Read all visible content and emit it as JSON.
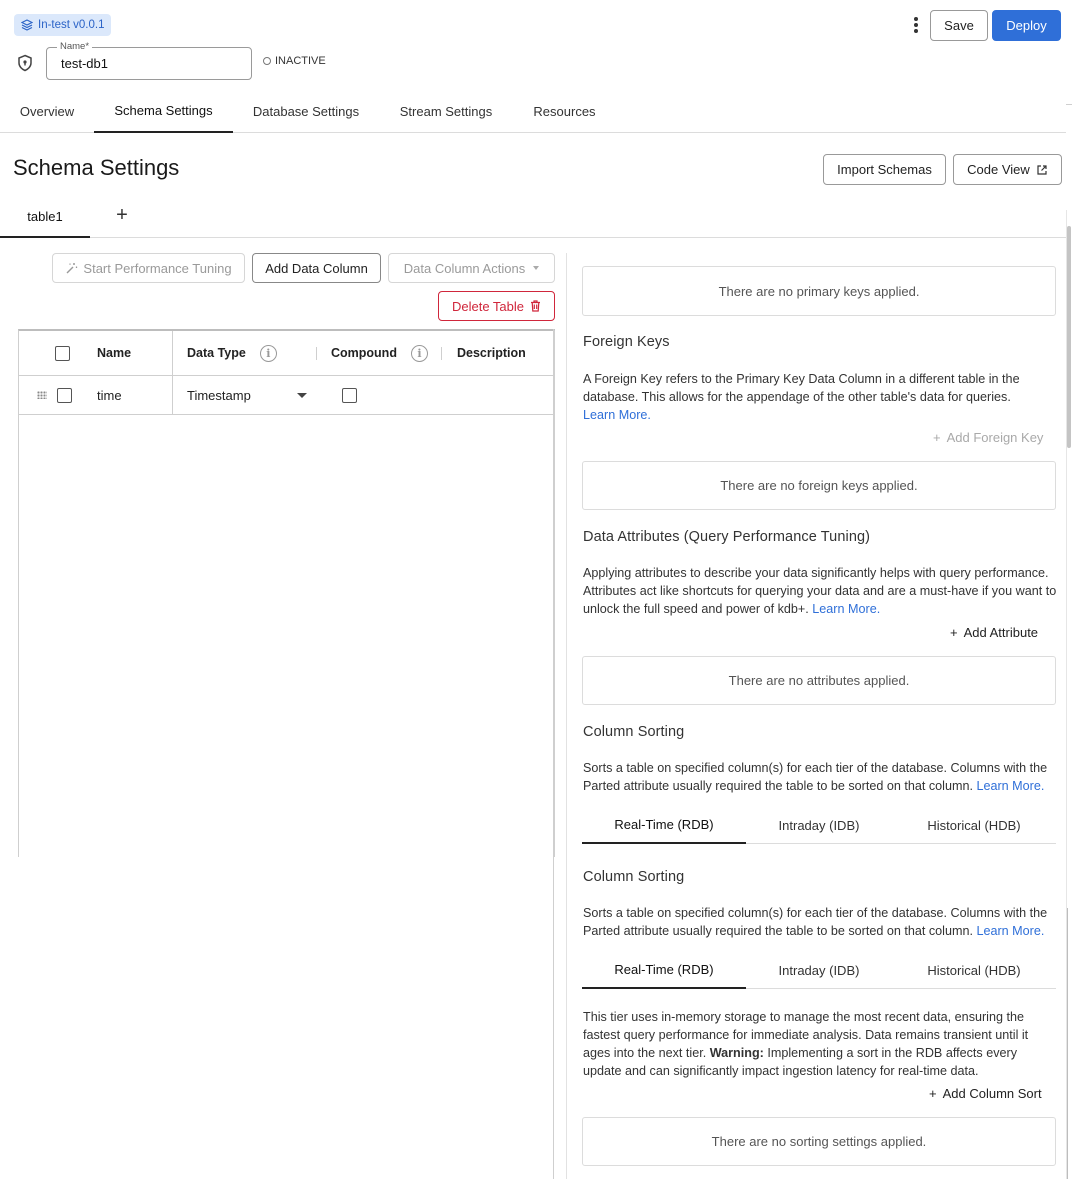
{
  "header": {
    "version_badge": "In-test v0.0.1",
    "name_label": "Name*",
    "name_value": "test-db1",
    "status": "INACTIVE",
    "save_label": "Save",
    "deploy_label": "Deploy",
    "accent_color": "#2f6fd8"
  },
  "nav": {
    "tabs": [
      {
        "label": "Overview"
      },
      {
        "label": "Schema Settings"
      },
      {
        "label": "Database Settings"
      },
      {
        "label": "Stream Settings"
      },
      {
        "label": "Resources"
      }
    ],
    "active": "Schema Settings"
  },
  "page": {
    "title": "Schema Settings",
    "import_label": "Import Schemas",
    "code_view_label": "Code View"
  },
  "table_tabs": {
    "items": [
      {
        "label": "table1"
      }
    ],
    "add_symbol": "+"
  },
  "toolbar": {
    "start_tuning": "Start Performance Tuning",
    "add_column": "Add Data Column",
    "column_actions": "Data Column Actions",
    "delete_table": "Delete Table"
  },
  "grid": {
    "headers": {
      "name": "Name",
      "data_type": "Data Type",
      "compound": "Compound",
      "description": "Description"
    },
    "rows": [
      {
        "name": "time",
        "data_type": "Timestamp",
        "compound": false,
        "description": ""
      }
    ]
  },
  "right": {
    "primary_empty": "There are no primary keys applied.",
    "foreign": {
      "title": "Foreign Keys",
      "text": "A Foreign Key refers to the Primary Key Data Column in a different table in the database. This allows for the appendage of the other table's data for queries.",
      "learn_more": "Learn More.",
      "add_label": "Add Foreign Key",
      "empty": "There are no foreign keys applied."
    },
    "attributes": {
      "title": "Data Attributes (Query Performance Tuning)",
      "text": "Applying attributes to describe your data significantly helps with query performance. Attributes act like shortcuts for querying your data and are a must-have if you want to unlock the full speed and power of kdb+.",
      "learn_more": "Learn More.",
      "add_label": "Add Attribute",
      "empty": "There are no attributes applied."
    },
    "sorting1": {
      "title": "Column Sorting",
      "text": "Sorts a table on specified column(s) for each tier of the database. Columns with the Parted attribute usually required the table to be sorted on that column.",
      "learn_more": "Learn More.",
      "tiers": [
        "Real-Time (RDB)",
        "Intraday (IDB)",
        "Historical (HDB)"
      ]
    },
    "sorting2": {
      "title": "Column Sorting",
      "text": "Sorts a table on specified column(s) for each tier of the database. Columns with the Parted attribute usually required the table to be sorted on that column.",
      "learn_more": "Learn More.",
      "tiers": [
        "Real-Time (RDB)",
        "Intraday (IDB)",
        "Historical (HDB)"
      ],
      "tier_text": "This tier uses in-memory storage to manage the most recent data, ensuring the fastest query performance for immediate analysis. Data remains transient until it ages into the next tier.",
      "warning_label": "Warning:",
      "warning_text": "Implementing a sort in the RDB affects every update and can significantly impact ingestion latency for real-time data.",
      "add_label": "Add Column Sort",
      "empty": "There are no sorting settings applied."
    }
  }
}
